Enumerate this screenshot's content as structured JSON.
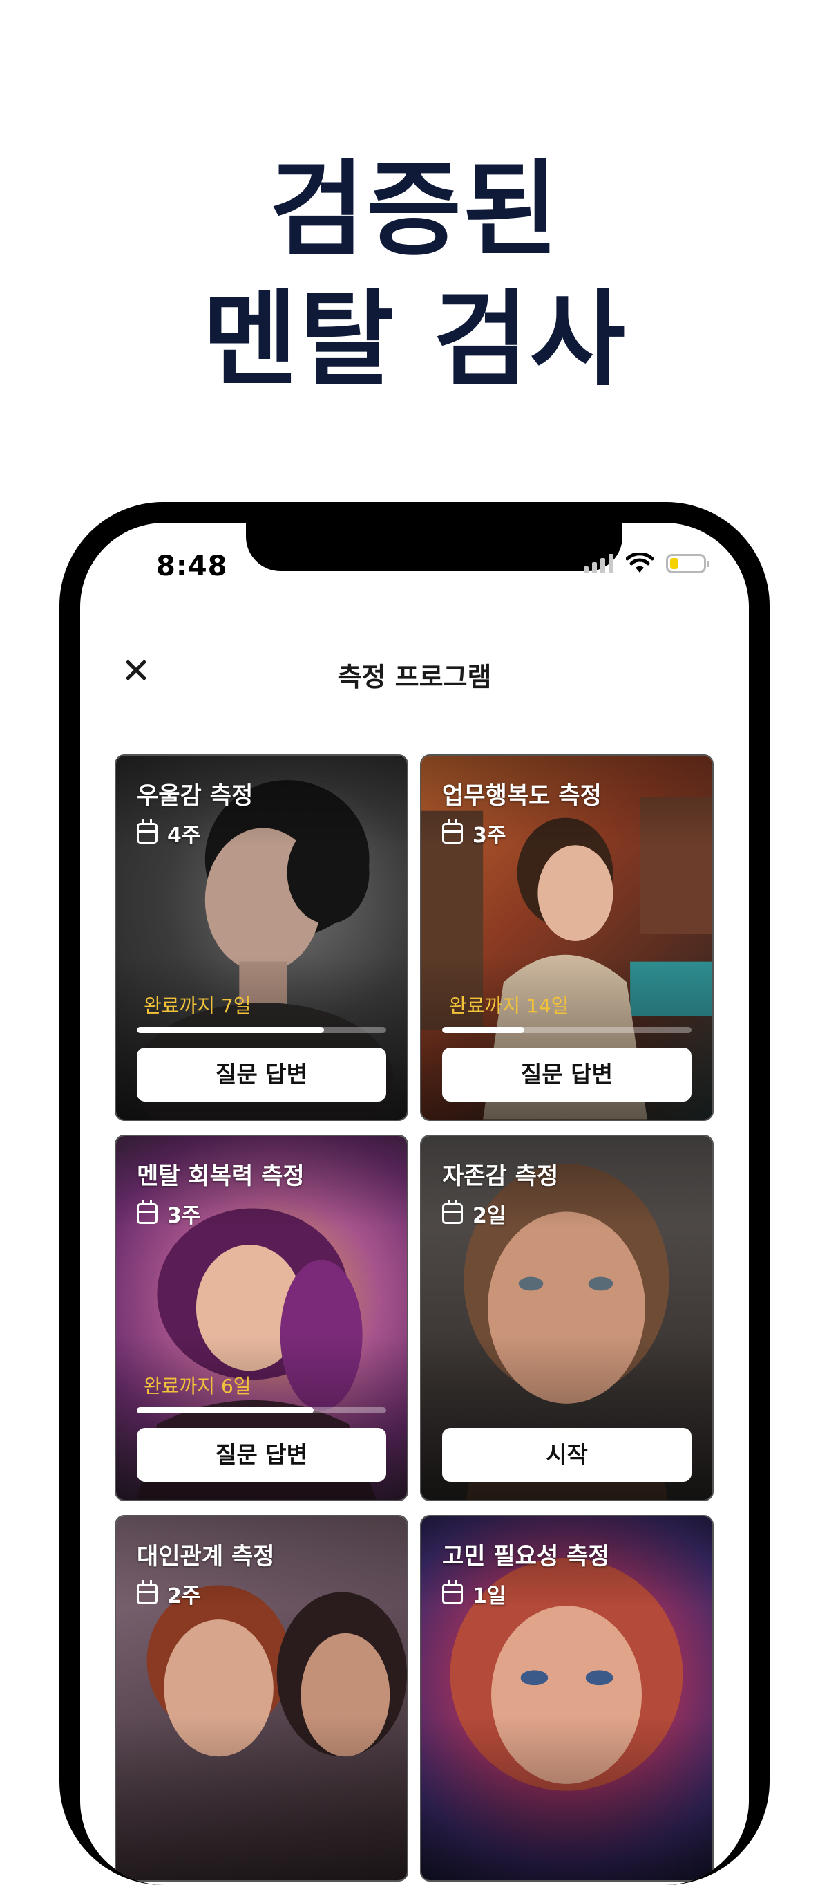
{
  "headline": {
    "line1": "검증된",
    "line2": "멘탈 검사"
  },
  "status_bar": {
    "time": "8:48",
    "battery_level": 0.25,
    "battery_color": "#f5d100"
  },
  "nav": {
    "title": "측정 프로그램",
    "close_icon": "close-icon"
  },
  "colors": {
    "headline": "#0f1a38",
    "remaining_text": "#f2c23a"
  },
  "cards": [
    {
      "title": "우울감 측정",
      "duration": "4주",
      "remaining": "완료까지 7일",
      "progress": 0.75,
      "button": "질문 답변"
    },
    {
      "title": "업무행복도 측정",
      "duration": "3주",
      "remaining": "완료까지 14일",
      "progress": 0.33,
      "button": "질문 답변"
    },
    {
      "title": "멘탈 회복력 측정",
      "duration": "3주",
      "remaining": "완료까지 6일",
      "progress": 0.71,
      "button": "질문 답변"
    },
    {
      "title": "자존감 측정",
      "duration": "2일",
      "button": "시작"
    },
    {
      "title": "대인관계 측정",
      "duration": "2주"
    },
    {
      "title": "고민 필요성 측정",
      "duration": "1일"
    }
  ]
}
